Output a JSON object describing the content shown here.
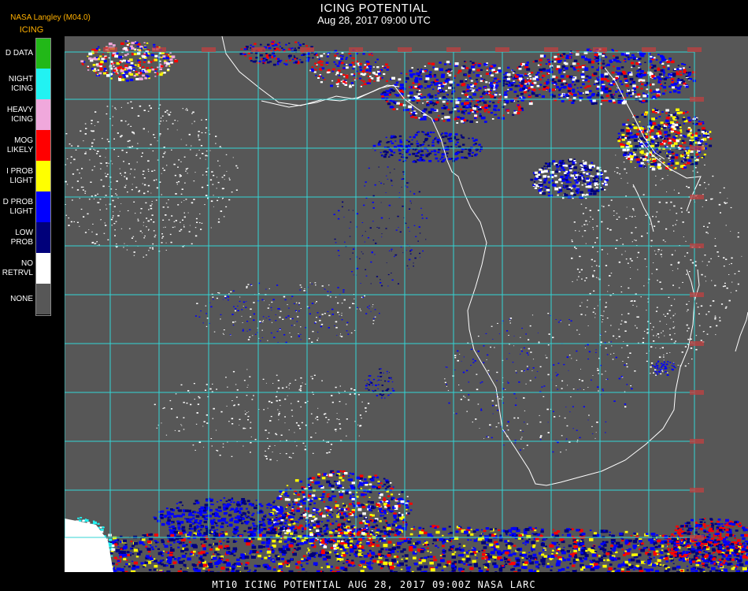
{
  "header": {
    "title": "ICING POTENTIAL",
    "subtitle": "Aug 28, 2017 09:00 UTC",
    "source": "NASA Langley (M04.0)",
    "legend_title": "ICING"
  },
  "legend": [
    {
      "label": "D DATA",
      "color": "#22b818"
    },
    {
      "label": "NIGHT\nICING",
      "color": "#22f2f2"
    },
    {
      "label": "HEAVY\nICING",
      "color": "#f0a8dc"
    },
    {
      "label": "MOG\nLIKELY",
      "color": "#ff0000"
    },
    {
      "label": "I PROB\nLIGHT",
      "color": "#ffff00"
    },
    {
      "label": "D PROB\nLIGHT",
      "color": "#0000ff"
    },
    {
      "label": "LOW\nPROB",
      "color": "#00007a"
    },
    {
      "label": "NO\nRETRVL",
      "color": "#ffffff"
    },
    {
      "label": "NONE",
      "color": "#575757"
    }
  ],
  "map": {
    "background": "#575757",
    "grid_color": "#33d6d6",
    "coast_color": "#ffffff",
    "label_color": "#c04040"
  },
  "footer": {
    "text": "MT10  ICING POTENTIAL   AUG 28, 2017 09:00Z   NASA LARC"
  }
}
